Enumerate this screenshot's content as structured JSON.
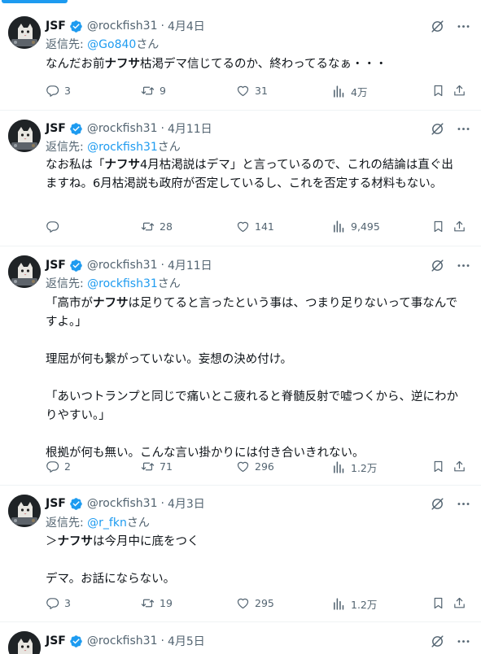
{
  "colors": {
    "accent": "#1d9bf0",
    "muted": "#536471",
    "text": "#0f1419",
    "border": "#eff3f4"
  },
  "tweets": [
    {
      "name": "JSF",
      "handle": "@rockfish31",
      "dot": "·",
      "time": "4月4日",
      "reply_prefix": "返信先: ",
      "reply_mention": "@Go840",
      "reply_suffix": "さん",
      "body": [
        {
          "t": "なんだお前",
          "b": false
        },
        {
          "t": "ナフサ",
          "b": true
        },
        {
          "t": "枯渇デマ信じてるのか、終わってるなぁ・・・",
          "b": false
        }
      ],
      "replies": "3",
      "retweets": "9",
      "likes": "31",
      "views": "4万"
    },
    {
      "name": "JSF",
      "handle": "@rockfish31",
      "dot": "·",
      "time": "4月11日",
      "reply_prefix": "返信先: ",
      "reply_mention": "@rockfish31",
      "reply_suffix": "さん",
      "body": [
        {
          "t": "なお私は「",
          "b": false
        },
        {
          "t": "ナフサ",
          "b": true
        },
        {
          "t": "4月枯渇説はデマ」と言っているので、これの結論は直ぐ出ますね。6月枯渇説も政府が否定しているし、これを否定する材料もない。",
          "b": false
        }
      ],
      "replies": "",
      "retweets": "28",
      "likes": "141",
      "views": "9,495"
    },
    {
      "name": "JSF",
      "handle": "@rockfish31",
      "dot": "·",
      "time": "4月11日",
      "reply_prefix": "返信先: ",
      "reply_mention": "@rockfish31",
      "reply_suffix": "さん",
      "body": [
        {
          "t": "「高市が",
          "b": false
        },
        {
          "t": "ナフサ",
          "b": true
        },
        {
          "t": "は足りてると言ったという事は、つまり足りないって事なんですよ。」\n\n理屈が何も繋がっていない。妄想の決め付け。\n\n「あいつトランプと同じで痛いとこ疲れると脊髄反射で嘘つくから、逆にわかりやすい。」\n\n根拠が何も無い。こんな言い掛かりには付き合いきれない。",
          "b": false
        }
      ],
      "replies": "2",
      "retweets": "71",
      "likes": "296",
      "views": "1.2万"
    },
    {
      "name": "JSF",
      "handle": "@rockfish31",
      "dot": "·",
      "time": "4月3日",
      "reply_prefix": "返信先: ",
      "reply_mention": "@r_fkn",
      "reply_suffix": "さん",
      "body": [
        {
          "t": "＞",
          "b": false
        },
        {
          "t": "ナフサ",
          "b": true
        },
        {
          "t": "は今月中に底をつく\n\nデマ。お話にならない。",
          "b": false
        }
      ],
      "replies": "3",
      "retweets": "19",
      "likes": "295",
      "views": "1.2万"
    },
    {
      "name": "JSF",
      "handle": "@rockfish31",
      "dot": "·",
      "time": "4月5日"
    }
  ]
}
